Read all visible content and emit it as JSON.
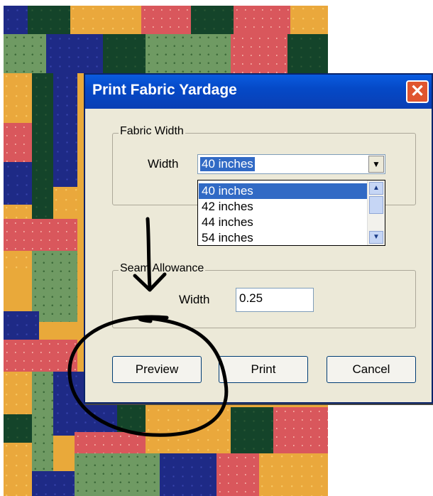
{
  "dialog": {
    "title": "Print Fabric Yardage",
    "close_glyph": "✕"
  },
  "fabric_width": {
    "group_label": "Fabric Width",
    "width_label": "Width",
    "selected_value": "40 inches",
    "options": [
      "40 inches",
      "42 inches",
      "44 inches",
      "54 inches"
    ]
  },
  "seam_allowance": {
    "group_label": "Seam Allowance",
    "width_label": "Width",
    "value": "0.25"
  },
  "buttons": {
    "preview": "Preview",
    "print": "Print",
    "cancel": "Cancel"
  },
  "icons": {
    "close": "close-icon",
    "dropdown": "chevron-down-icon",
    "scroll_up": "scroll-up-icon",
    "scroll_down": "scroll-down-icon"
  },
  "colors": {
    "titlebar": "#0a5ce0",
    "selection": "#316ac5",
    "dialog_bg": "#ece9d8",
    "close_button": "#e0552f",
    "annotation": "#000000"
  }
}
